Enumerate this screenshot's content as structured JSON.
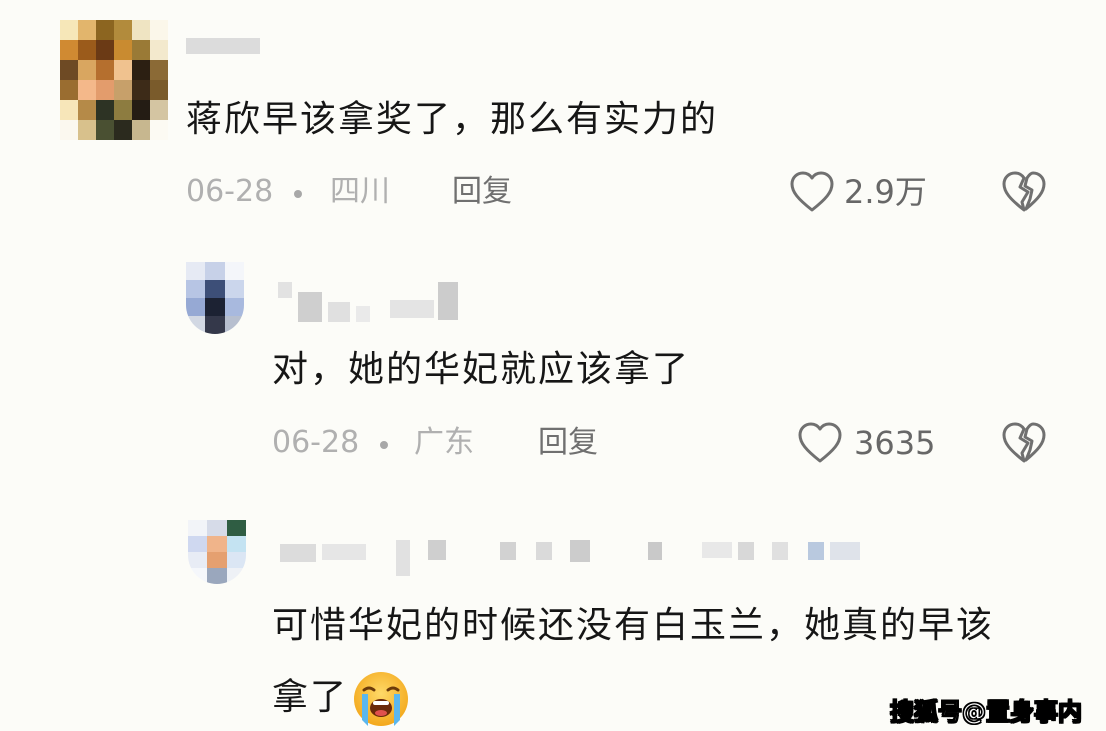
{
  "comments": [
    {
      "text": "蒋欣早该拿奖了，那么有实力的",
      "date": "06-28",
      "location": "四川",
      "reply_label": "回复",
      "like_count": "2.9万"
    },
    {
      "text": "对，她的华妃就应该拿了",
      "date": "06-28",
      "location": "广东",
      "reply_label": "回复",
      "like_count": "3635"
    },
    {
      "text_line1": "可惜华妃的时候还没有白玉兰，她真的早该",
      "text_line2": "拿了"
    }
  ],
  "icons": {
    "like": "heart-outline-icon",
    "dislike": "broken-heart-icon",
    "emoji": "loudly-crying-face-emoji"
  },
  "colors": {
    "background": "#fcfcf8",
    "text": "#161616",
    "meta": "#b0b0b0",
    "icon": "#707070"
  },
  "watermark": "搜狐号@置身事内"
}
